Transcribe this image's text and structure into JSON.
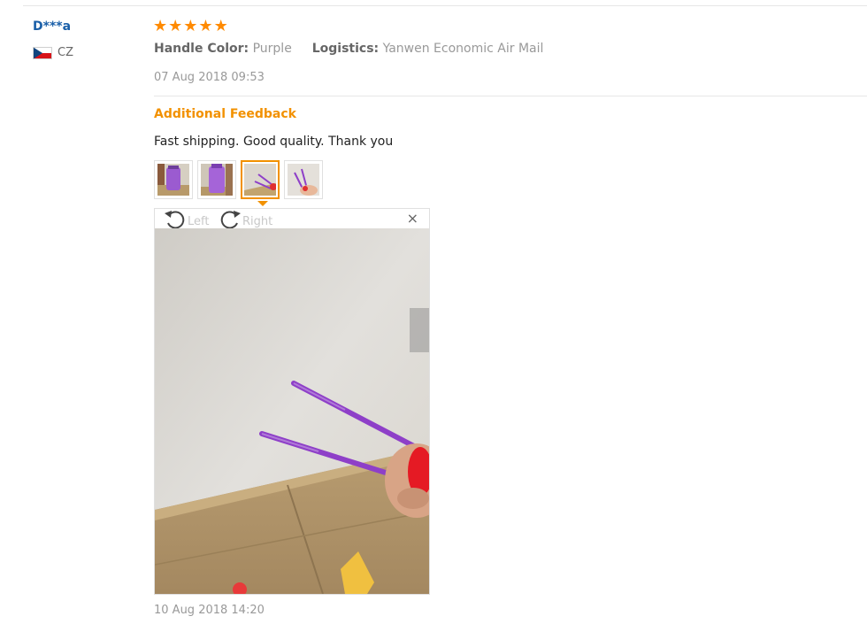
{
  "review": {
    "user_name": "D***a",
    "country_code": "CZ",
    "rating": 5,
    "stars": [
      "★",
      "★",
      "★",
      "★",
      "★"
    ],
    "attributes": [
      {
        "label": "Handle Color:",
        "value": "Purple"
      },
      {
        "label": "Logistics:",
        "value": "Yanwen Economic Air Mail"
      }
    ],
    "date": "07 Aug 2018 09:53"
  },
  "additional_feedback": {
    "heading": "Additional Feedback",
    "text": "Fast shipping. Good quality. Thank you",
    "date": "10 Aug 2018 14:20",
    "selected_thumbnail": 3,
    "thumbnail_count": 4
  },
  "viewer": {
    "rotate_left_label": "Left",
    "rotate_right_label": "Right",
    "close_glyph": "×"
  },
  "colors": {
    "accent_orange": "#f29100",
    "star_orange": "#ff8a00",
    "user_blue": "#1a5fa8",
    "product_purple": "#8e3fc8"
  }
}
